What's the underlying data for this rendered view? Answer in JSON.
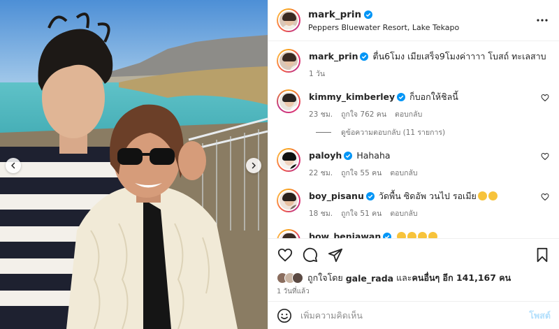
{
  "post": {
    "username": "mark_prin",
    "location": "Peppers Bluewater Resort, Lake Tekapo"
  },
  "caption": {
    "username": "mark_prin",
    "text": "ตื่น6โมง เมียเสร็จ9โมงค่าาาา โบสถ์ ทะเลสาบ",
    "time": "1 วัน"
  },
  "comments": [
    {
      "username": "kimmy_kimberley",
      "text": "ก็บอกให้ชิลนี้",
      "time": "23 ชม.",
      "likes": "ถูกใจ 762 คน",
      "reply": "ตอบกลับ"
    },
    {
      "username": "paloyh",
      "text": "Hahaha",
      "time": "22 ชม.",
      "likes": "ถูกใจ 55 คน",
      "reply": "ตอบกลับ"
    },
    {
      "username": "boy_pisanu",
      "text": "วัดพื้น ซิดอัพ วนไป รอเมีย",
      "time": "18 ชม.",
      "likes": "ถูกใจ 51 คน",
      "reply": "ตอบกลับ"
    },
    {
      "username": "bow_benjawan",
      "text": ""
    }
  ],
  "view_replies": "ดูข้อความตอบกลับ (11 รายการ)",
  "likes": {
    "prefix": "ถูกใจโดย",
    "user": "gale_rada",
    "middle": "และ",
    "others": "คนอื่นๆ อีก 141,167 คน"
  },
  "posted_ago": "1 วันที่แล้ว",
  "comment_box": {
    "placeholder": "เพิ่มความคิดเห็น",
    "post_label": "โพสต์"
  },
  "icons": {
    "verified": "verified-badge-icon",
    "more": "more-options-icon",
    "like": "heart-icon",
    "comment": "comment-icon",
    "share": "share-icon",
    "save": "bookmark-icon",
    "emoji": "emoji-icon",
    "prev": "chevron-left-icon",
    "next": "chevron-right-icon"
  },
  "colors": {
    "verified": "#0095f6",
    "text": "#262626",
    "muted": "#737373",
    "post_disabled": "#b2dffc"
  }
}
